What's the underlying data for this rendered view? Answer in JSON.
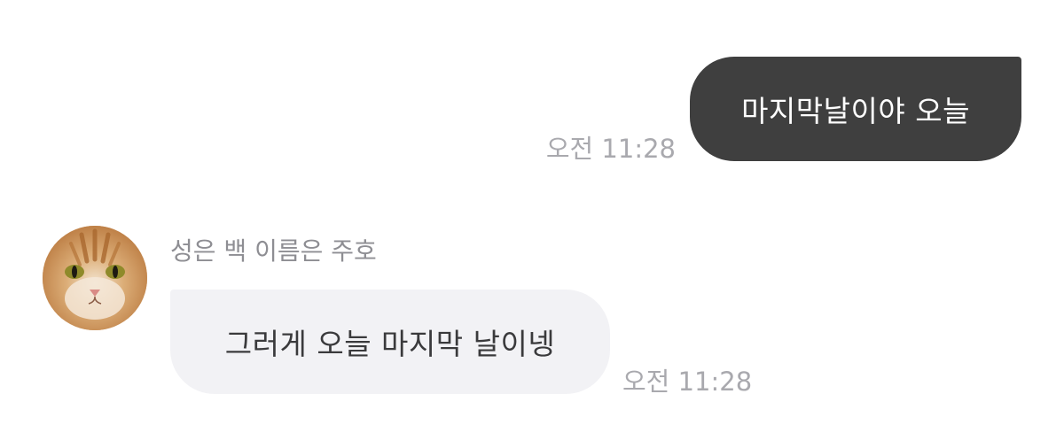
{
  "messages": {
    "sent": {
      "text": "마지막날이야 오늘",
      "time": "오전 11:28"
    },
    "received": {
      "sender_name": "성은 백 이름은 주호",
      "avatar_icon": "cat-avatar-icon",
      "text": "그러게 오늘 마지막 날이넹",
      "time": "오전 11:28"
    }
  },
  "colors": {
    "sent_bubble": "#3f3f3f",
    "received_bubble": "#f2f2f5",
    "timestamp": "#a9a9ae",
    "sender_name": "#8e8e93"
  }
}
